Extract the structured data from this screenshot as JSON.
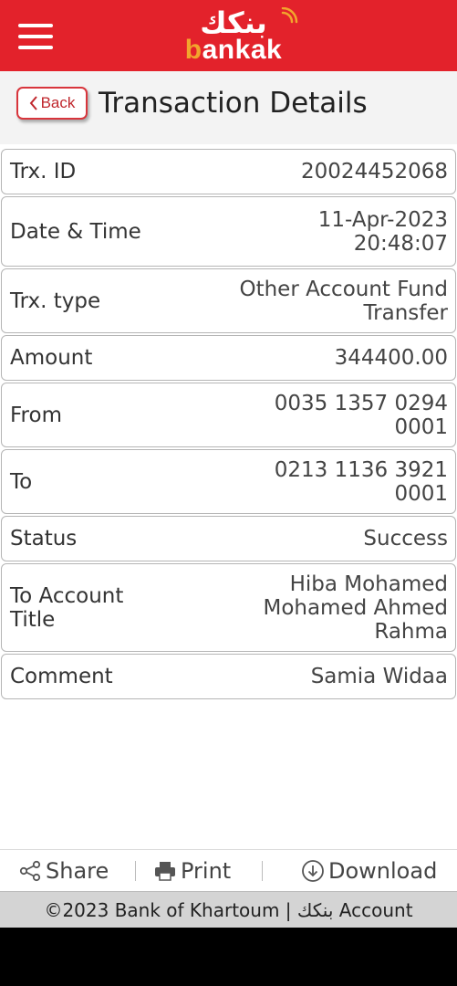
{
  "header": {
    "logo_arabic": "بنكك",
    "logo_latin_b": "b",
    "logo_latin_rest": "ankak",
    "colors": {
      "bar": "#e3222b",
      "accent": "#f2a52d"
    }
  },
  "titlebar": {
    "back_label": "Back",
    "title": "Transaction Details"
  },
  "details": [
    {
      "label": "Trx. ID",
      "value": "20024452068"
    },
    {
      "label": "Date & Time",
      "value": "11-Apr-2023\n20:48:07"
    },
    {
      "label": "Trx. type",
      "value": "Other Account Fund\nTransfer"
    },
    {
      "label": "Amount",
      "value": "344400.00"
    },
    {
      "label": "From",
      "value": "0035 1357 0294\n0001"
    },
    {
      "label": "To",
      "value": "0213 1136 3921\n0001"
    },
    {
      "label": "Status",
      "value": "Success"
    },
    {
      "label": "To Account\nTitle",
      "value": "Hiba Mohamed\nMohamed Ahmed\nRahma"
    },
    {
      "label": "Comment",
      "value": "Samia Widaa"
    }
  ],
  "actions": {
    "share": "Share",
    "print": "Print",
    "download": "Download"
  },
  "footer": {
    "text": "©2023 Bank of Khartoum | بنكك Account"
  }
}
